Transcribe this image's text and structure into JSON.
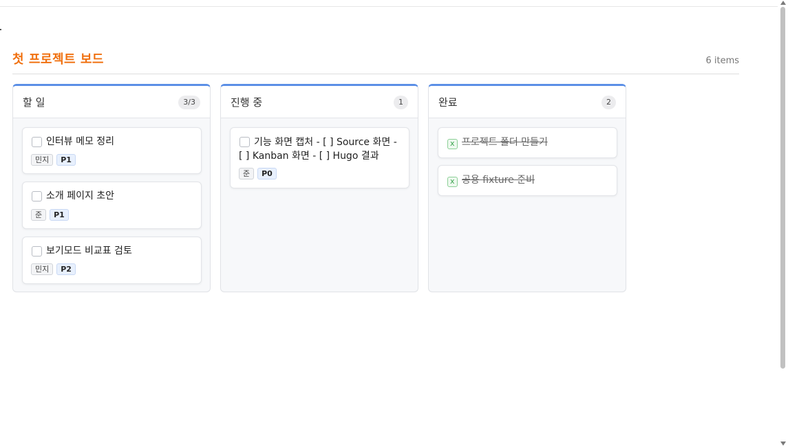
{
  "board": {
    "title": "첫 프로젝트 보드",
    "item_count": "6 items"
  },
  "colors": {
    "title_accent": "#f0700f",
    "column_accent": "#5b8fe6",
    "done_check": "#3ca450"
  },
  "columns": [
    {
      "title": "할 일",
      "badge": "3/3",
      "cards": [
        {
          "text": "인터뷰 메모 정리",
          "person": "민지",
          "priority": "P1",
          "done": false
        },
        {
          "text": "소개 페이지 초안",
          "person": "준",
          "priority": "P1",
          "done": false
        },
        {
          "text": "보기모드 비교표 검토",
          "person": "민지",
          "priority": "P2",
          "done": false
        }
      ]
    },
    {
      "title": "진행 중",
      "badge": "1",
      "cards": [
        {
          "text": "기능 화면 캡처 - [ ] Source 화면 - [ ] Kanban 화면 - [ ] Hugo 결과",
          "person": "준",
          "priority": "P0",
          "done": false
        }
      ]
    },
    {
      "title": "완료",
      "badge": "2",
      "cards": [
        {
          "text": "프로젝트 폴더 만들기",
          "check_mark": "x",
          "done": true
        },
        {
          "text": "공용 fixture 준비",
          "check_mark": "x",
          "done": true
        }
      ]
    }
  ]
}
